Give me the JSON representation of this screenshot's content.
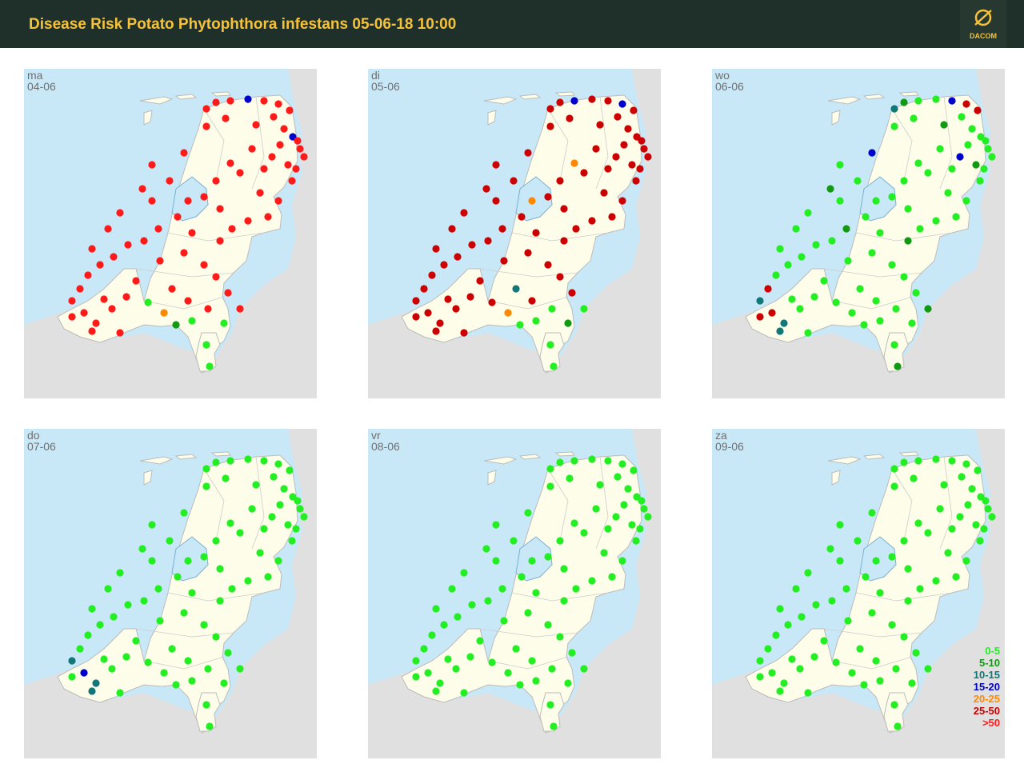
{
  "header": {
    "title": "Disease Risk Potato Phytophthora infestans 05-06-18 10:00",
    "logo_text": "DACOM",
    "logo_icon": "dacom-globe-icon",
    "background_color": "#1f302b",
    "title_color": "#f5c23a"
  },
  "panels": [
    {
      "day": "ma",
      "date": "04-06",
      "dominant_color": "#ff1a1a"
    },
    {
      "day": "di",
      "date": "05-06",
      "dominant_color": "#cc0000"
    },
    {
      "day": "wo",
      "date": "06-06",
      "dominant_color": "#22ee22"
    },
    {
      "day": "do",
      "date": "07-06",
      "dominant_color": "#22ee22"
    },
    {
      "day": "vr",
      "date": "08-06",
      "dominant_color": "#22ee22"
    },
    {
      "day": "za",
      "date": "09-06",
      "dominant_color": "#22ee22"
    }
  ],
  "legend": {
    "items": [
      {
        "label": "0-5",
        "color": "#22ee22"
      },
      {
        "label": "5-10",
        "color": "#119911"
      },
      {
        "label": "10-15",
        "color": "#117777"
      },
      {
        "label": "15-20",
        "color": "#0000cc"
      },
      {
        "label": "20-25",
        "color": "#ff8800"
      },
      {
        "label": "25-50",
        "color": "#cc0000"
      },
      {
        "label": ">50",
        "color": "#ff1a1a"
      }
    ]
  }
}
